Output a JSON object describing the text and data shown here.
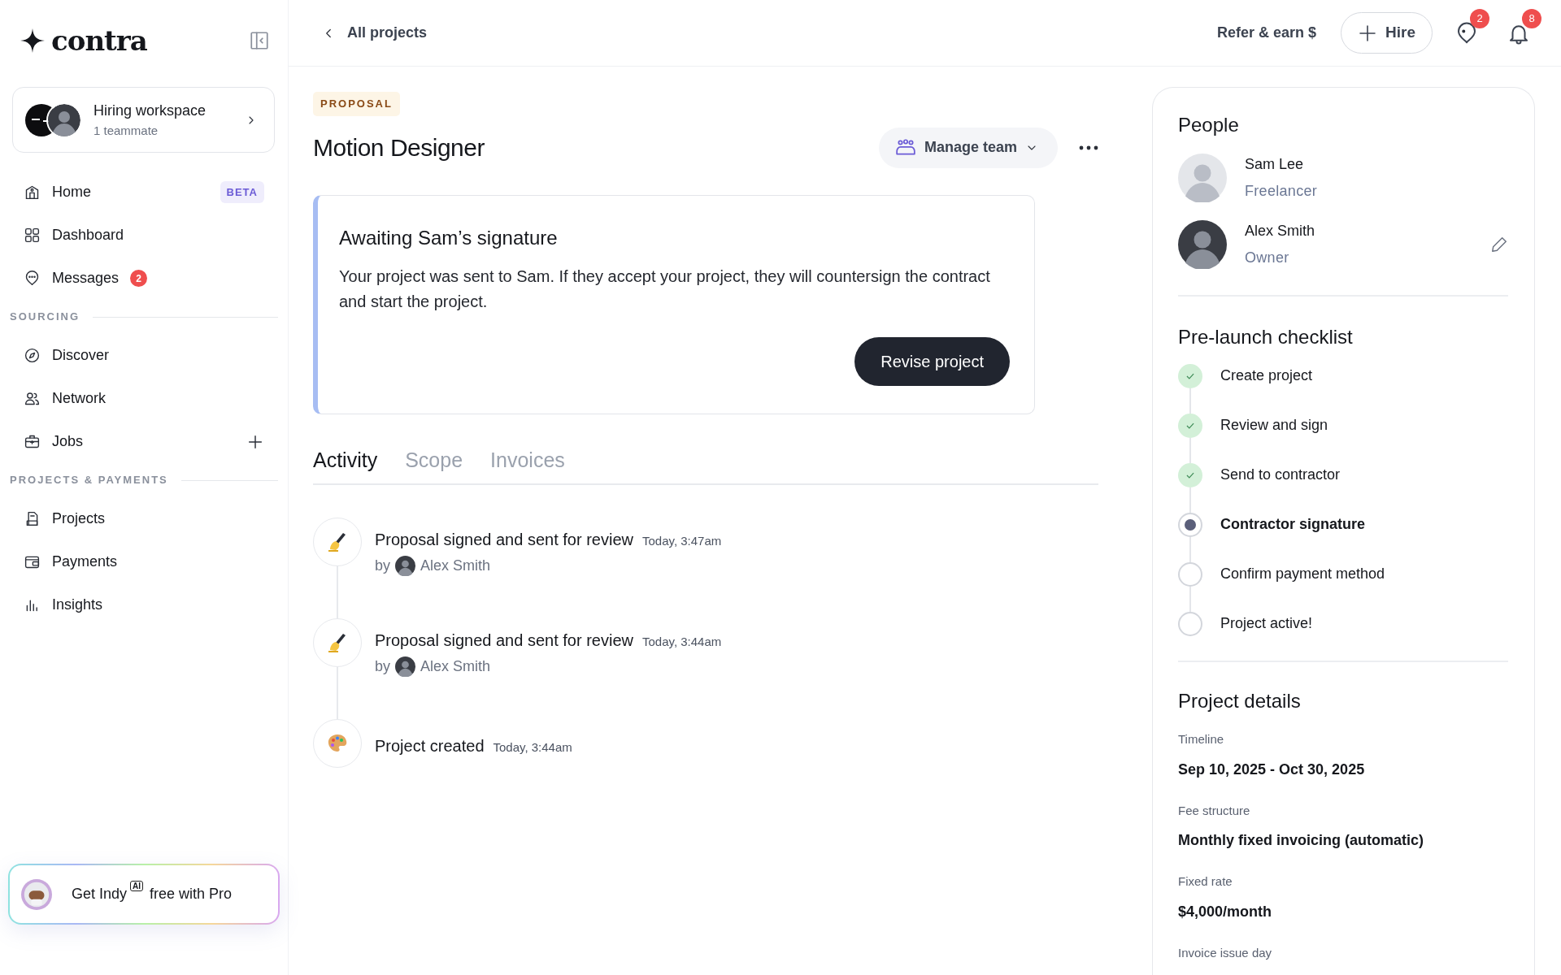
{
  "brand": "contra",
  "workspace": {
    "title": "Hiring workspace",
    "subtitle": "1 teammate"
  },
  "nav": [
    {
      "label": "Home",
      "badge": "BETA"
    },
    {
      "label": "Dashboard"
    },
    {
      "label": "Messages",
      "count": "2"
    }
  ],
  "sections": [
    {
      "heading": "SOURCING",
      "items": [
        {
          "label": "Discover"
        },
        {
          "label": "Network"
        },
        {
          "label": "Jobs",
          "add": true
        }
      ]
    },
    {
      "heading": "PROJECTS & PAYMENTS",
      "items": [
        {
          "label": "Projects"
        },
        {
          "label": "Payments"
        },
        {
          "label": "Insights"
        }
      ]
    }
  ],
  "promo": {
    "text": "Get Indy",
    "tag": "AI",
    "suffix": "free with Pro"
  },
  "header": {
    "back": "All projects",
    "refer": "Refer & earn $",
    "hire": "Hire",
    "messages_count": "2",
    "notifications_count": "8"
  },
  "project": {
    "tag": "PROPOSAL",
    "title": "Motion Designer",
    "manage": "Manage team"
  },
  "notice": {
    "title": "Awaiting Sam’s signature",
    "body": "Your project was sent to Sam. If they accept your project, they will countersign the contract and start the project.",
    "button": "Revise project"
  },
  "tabs": [
    {
      "label": "Activity",
      "selected": true
    },
    {
      "label": "Scope",
      "selected": false
    },
    {
      "label": "Invoices",
      "selected": false
    }
  ],
  "activity": [
    {
      "kind": "signed",
      "title": "Proposal signed and sent for review",
      "time": "Today, 3:47am",
      "by": "by",
      "author": "Alex Smith"
    },
    {
      "kind": "signed",
      "title": "Proposal signed and sent for review",
      "time": "Today, 3:44am",
      "by": "by",
      "author": "Alex Smith"
    },
    {
      "kind": "created",
      "title": "Project created",
      "time": "Today, 3:44am"
    }
  ],
  "people": {
    "heading": "People",
    "members": [
      {
        "name": "Sam Lee",
        "role": "Freelancer",
        "editable": false
      },
      {
        "name": "Alex Smith",
        "role": "Owner",
        "editable": true
      }
    ]
  },
  "checklist": {
    "heading": "Pre-launch checklist",
    "steps": [
      {
        "kind": "done",
        "label": "Create project"
      },
      {
        "kind": "done",
        "label": "Review and sign"
      },
      {
        "kind": "done",
        "label": "Send to contractor"
      },
      {
        "kind": "current",
        "label": "Contractor signature"
      },
      {
        "kind": "pending",
        "label": "Confirm payment method"
      },
      {
        "kind": "pending",
        "label": "Project active!"
      }
    ]
  },
  "details": {
    "heading": "Project details",
    "fields": [
      {
        "label": "Timeline",
        "value": "Sep 10, 2025 - Oct 30, 2025"
      },
      {
        "label": "Fee structure",
        "value": "Monthly fixed invoicing (automatic)"
      },
      {
        "label": "Fixed rate",
        "value": "$4,000/month"
      },
      {
        "label": "Invoice issue day"
      }
    ]
  }
}
